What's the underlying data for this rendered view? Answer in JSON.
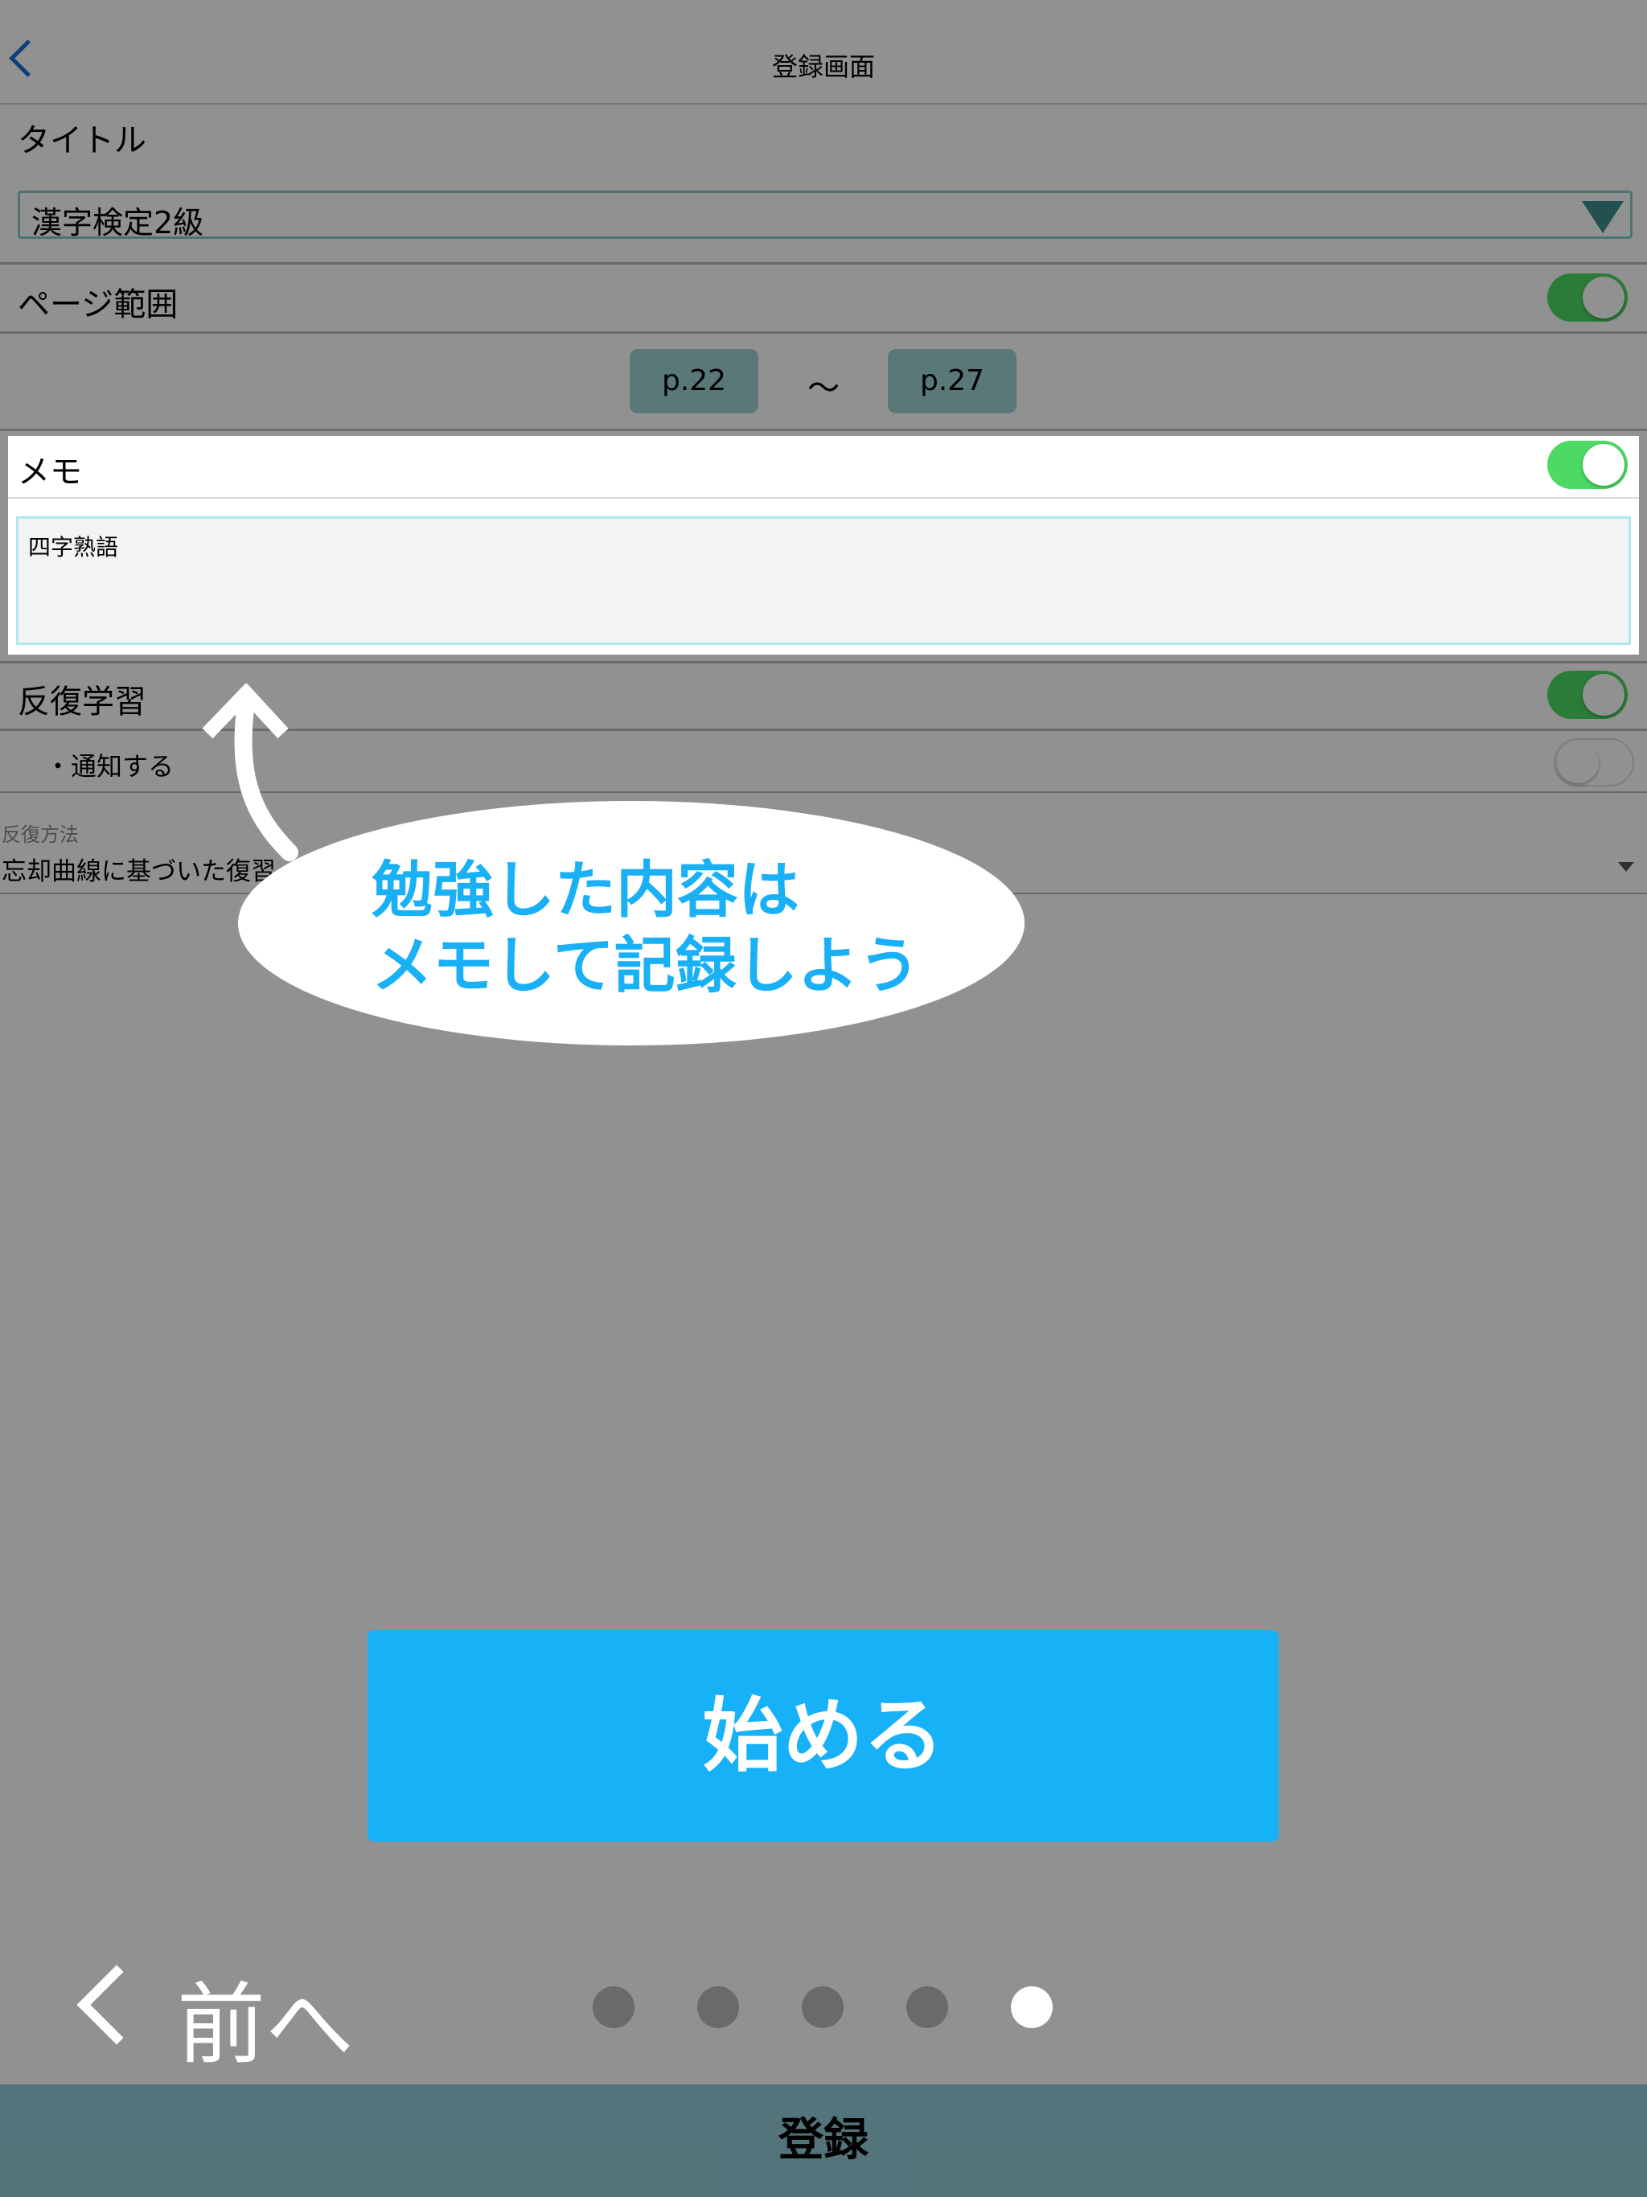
{
  "nav": {
    "title": "登録画面"
  },
  "title_section": {
    "label": "タイトル",
    "selected": "漢字検定2級"
  },
  "page_range": {
    "label": "ページ範囲",
    "enabled": true,
    "from": "p.22",
    "separator": "〜",
    "to": "p.27"
  },
  "memo": {
    "label": "メモ",
    "enabled": true,
    "text": "四字熟語"
  },
  "repeat": {
    "label": "反復学習",
    "enabled": true,
    "notify_label": "・通知する",
    "notify_enabled": false,
    "method_caption": "反復方法",
    "method_value": "忘却曲線に基づいた復習"
  },
  "tutorial": {
    "bubble_line1": "勉強した内容は",
    "bubble_line2": "メモして記録しよう",
    "start_label": "始める",
    "prev_label": "前へ",
    "dots_total": 5,
    "active_dot": 5
  },
  "bottom": {
    "register_label": "登録"
  },
  "colors": {
    "accent": "#17b1f7",
    "toggle_on": "#4cd964",
    "nav_tint": "#1a6fd6"
  }
}
